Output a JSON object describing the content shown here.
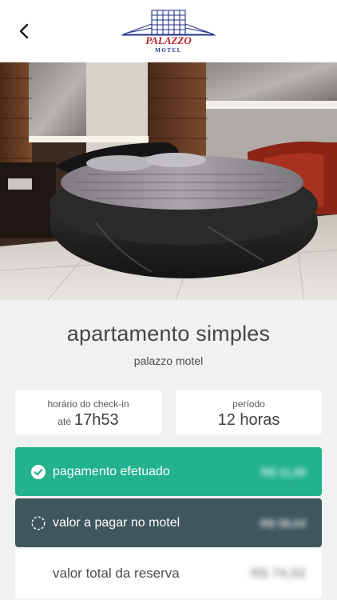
{
  "header": {
    "back_icon": "chevron-left-icon",
    "logo": {
      "name": "PALAZZO",
      "sub": "MOTEL"
    }
  },
  "room": {
    "title": "apartamento simples",
    "hotel": "palazzo motel"
  },
  "checkin": {
    "label": "horário do check-in",
    "prefix": "até",
    "time": "17h53"
  },
  "period": {
    "label": "período",
    "value": "12 horas"
  },
  "payment": {
    "paid_label": "pagamento efetuado",
    "paid_amount": "R$ 11,48",
    "paid_icon": "check-circle-icon",
    "due_label": "valor a pagar no motel",
    "due_amount": "R$ 58,04",
    "due_icon": "dashed-circle-icon",
    "total_label": "valor total da reserva",
    "total_amount": "R$ 74,52"
  },
  "colors": {
    "paid_bg": "#22b28d",
    "due_bg": "#3f565f",
    "logo_red": "#b4232b",
    "logo_blue": "#22348a"
  }
}
